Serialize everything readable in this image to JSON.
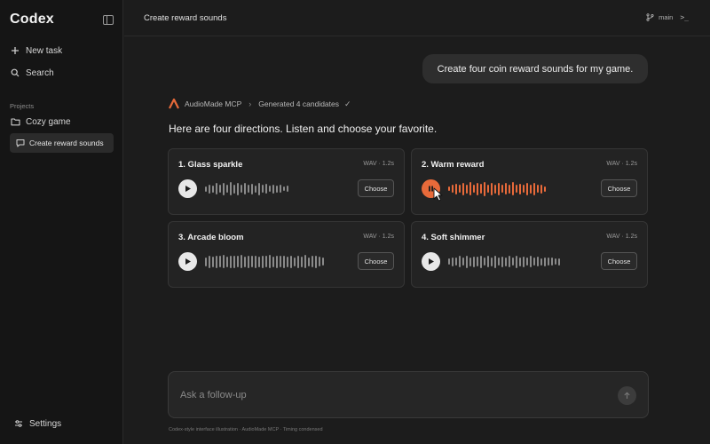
{
  "sidebar": {
    "brand": "Codex",
    "new_task": "New task",
    "search": "Search",
    "projects_label": "Projects",
    "project": "Cozy game",
    "active_task": "Create reward sounds",
    "settings": "Settings"
  },
  "header": {
    "title": "Create reward sounds",
    "branch": "main",
    "terminal": ">_"
  },
  "user_message": "Create four coin reward sounds for my game.",
  "tool": {
    "name": "AudioMade MCP",
    "status": "Generated 4 candidates",
    "check": "✓"
  },
  "intro": "Here are four directions. Listen and choose your favorite.",
  "cards": [
    {
      "title": "1. Glass sparkle",
      "meta": "WAV · 1.2s",
      "choose": "Choose",
      "playing": false,
      "wave": [
        0.35,
        0.6,
        0.45,
        0.75,
        0.55,
        0.8,
        0.5,
        0.9,
        0.6,
        0.85,
        0.5,
        0.75,
        0.55,
        0.7,
        0.45,
        0.8,
        0.5,
        0.65,
        0.4,
        0.6,
        0.45,
        0.55,
        0.3,
        0.4
      ]
    },
    {
      "title": "2. Warm reward",
      "meta": "WAV · 1.2s",
      "choose": "Choose",
      "playing": true,
      "wave": [
        0.3,
        0.5,
        0.7,
        0.55,
        0.85,
        0.6,
        0.9,
        0.5,
        0.8,
        0.65,
        0.95,
        0.55,
        0.8,
        0.6,
        0.85,
        0.5,
        0.75,
        0.6,
        0.9,
        0.5,
        0.7,
        0.55,
        0.8,
        0.6,
        0.85,
        0.5,
        0.6,
        0.35
      ]
    },
    {
      "title": "3. Arcade bloom",
      "meta": "WAV · 1.2s",
      "choose": "Choose",
      "playing": false,
      "wave": [
        0.6,
        0.8,
        0.7,
        0.85,
        0.75,
        0.9,
        0.7,
        0.8,
        0.85,
        0.75,
        0.9,
        0.7,
        0.8,
        0.75,
        0.85,
        0.7,
        0.8,
        0.75,
        0.9,
        0.7,
        0.8,
        0.75,
        0.85,
        0.7,
        0.8,
        0.6,
        0.85,
        0.7,
        0.9,
        0.6,
        0.75,
        0.8,
        0.65,
        0.55
      ]
    },
    {
      "title": "4. Soft shimmer",
      "meta": "WAV · 1.2s",
      "choose": "Choose",
      "playing": false,
      "wave": [
        0.4,
        0.6,
        0.5,
        0.75,
        0.55,
        0.8,
        0.6,
        0.7,
        0.65,
        0.85,
        0.55,
        0.75,
        0.6,
        0.8,
        0.5,
        0.7,
        0.6,
        0.75,
        0.55,
        0.8,
        0.6,
        0.7,
        0.5,
        0.75,
        0.55,
        0.65,
        0.45,
        0.6,
        0.5,
        0.55,
        0.4,
        0.45
      ]
    }
  ],
  "input": {
    "placeholder": "Ask a follow-up"
  },
  "footnote": "Codex-style interface illustration · AudioMade MCP · Timing condensed",
  "colors": {
    "accent": "#e86a3a",
    "background": "#1c1c1c",
    "sidebar": "#151515"
  }
}
